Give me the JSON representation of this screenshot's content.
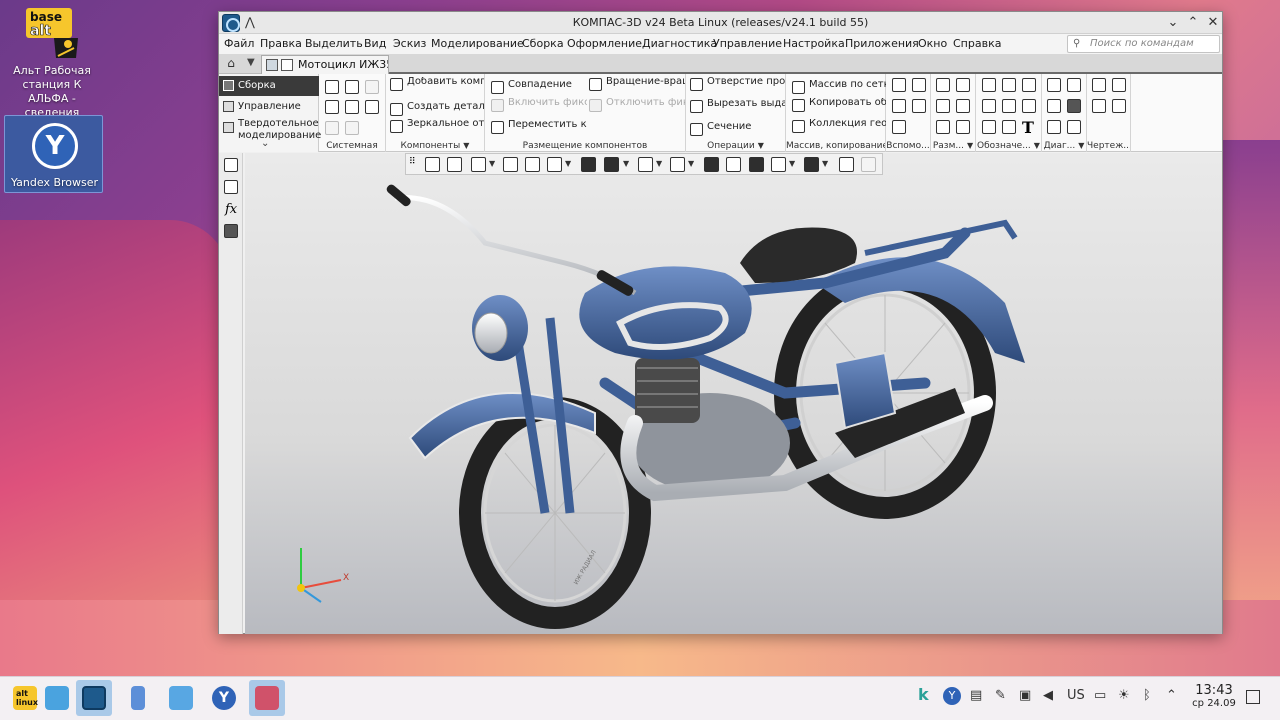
{
  "desktop": {
    "alt_logo_text": "base alt",
    "alt_label": "Альт Рабочая станция К АЛЬФА - сведения",
    "yandex_label": "Yandex Browser",
    "yandex_glyph": "Y"
  },
  "window": {
    "title": "КОМПАС-3D v24 Beta Linux (releases/v24.1 build 55)",
    "controls": {
      "minimize": "⌄",
      "maximize": "⌃",
      "close": "✕"
    },
    "up_glyph": "⋀"
  },
  "menu": {
    "items": [
      "Файл",
      "Правка",
      "Выделить",
      "Вид",
      "Эскиз",
      "Моделирование",
      "Сборка",
      "Оформление",
      "Диагностика",
      "Управление",
      "Настройка",
      "Приложения",
      "Окно",
      "Справка"
    ],
    "search_placeholder": "Поиск по командам (Alt+/)"
  },
  "docbar": {
    "home_glyph": "⌂",
    "tab_label": "Мотоцикл ИЖ35..."
  },
  "left_panel": {
    "items": [
      "Сборка",
      "Управление",
      "Твердотельное моделирование"
    ],
    "more_glyph": "⌄"
  },
  "ribbon": {
    "groups": {
      "system": "Системная",
      "components": "Компоненты",
      "placement": "Размещение компонентов",
      "operations": "Операции",
      "array": "Массив, копирование",
      "aux": "Вспомо...",
      "dims": "Разм...",
      "notation": "Обозначе...",
      "diag": "Диаг...",
      "drawing": "Чертеж..."
    },
    "buttons": {
      "add_component": "Добавить компонент из ф...",
      "create_part": "Создать деталь",
      "mirror": "Зеркальное отражение ком...",
      "coincidence": "Совпадение",
      "enable_fix": "Включить фиксацию",
      "move_component": "Переместить компонент",
      "rotation": "Вращение-вращение",
      "disable_fix": "Отключить фиксацию",
      "hole": "Отверстие простое",
      "cut_extrude": "Вырезать выдавливанием",
      "section": "Сечение",
      "grid_array": "Массив по сетке",
      "copy_objects": "Копировать объекты",
      "geometry_collection": "Коллекция геометрии"
    },
    "text_tool_glyph": "T"
  },
  "vtool": {
    "fx": "fx"
  },
  "viewport": {
    "triad_x": "X",
    "tire_text": "ИЖ РАДИАЛ",
    "colors": {
      "body": "#3e5f96",
      "chrome": "#dcdcdc",
      "tire": "#232323"
    }
  },
  "taskbar": {
    "tray_lang": "US",
    "tray_k": "k",
    "tray_y": "Y",
    "time": "13:43",
    "date": "ср 24.09",
    "start_text": "alt linux"
  }
}
